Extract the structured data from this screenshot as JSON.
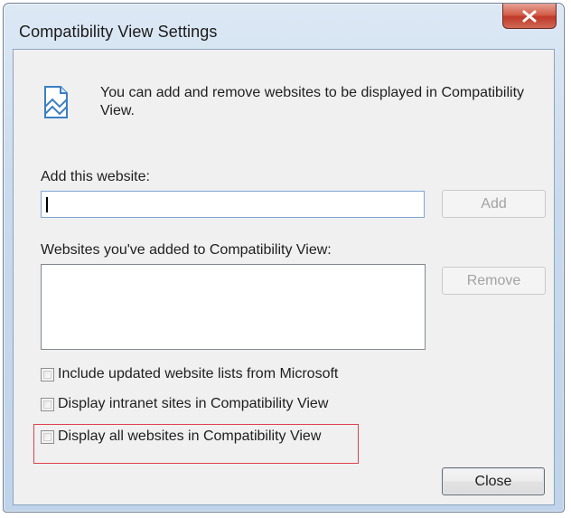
{
  "window": {
    "title": "Compatibility View Settings"
  },
  "info": {
    "text": "You can add and remove websites to be displayed in Compatibility View."
  },
  "add_section": {
    "label": "Add this website:",
    "input_value": "",
    "add_button": "Add"
  },
  "list_section": {
    "label": "Websites you've added to Compatibility View:",
    "items": [],
    "remove_button": "Remove"
  },
  "options": [
    {
      "label": "Include updated website lists from Microsoft",
      "checked": false
    },
    {
      "label": "Display intranet sites in Compatibility View",
      "checked": false
    },
    {
      "label": "Display all websites in Compatibility View",
      "checked": false,
      "highlighted": true
    }
  ],
  "footer": {
    "close_button": "Close"
  },
  "colors": {
    "highlight_box": "#e0414b",
    "close_button_red": "#c0392b"
  }
}
